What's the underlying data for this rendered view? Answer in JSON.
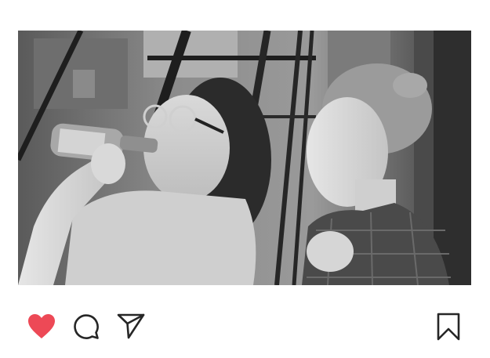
{
  "post": {
    "image": {
      "alt": "",
      "style": "black-and-white photo of two women on a fire escape"
    },
    "actions": {
      "like_icon": "heart-filled-icon",
      "comment_icon": "comment-bubble-icon",
      "share_icon": "paper-plane-icon",
      "save_icon": "bookmark-icon",
      "liked": true
    }
  },
  "colors": {
    "like_active": "#ed4956",
    "icon_stroke": "#262626",
    "background": "#ffffff"
  }
}
